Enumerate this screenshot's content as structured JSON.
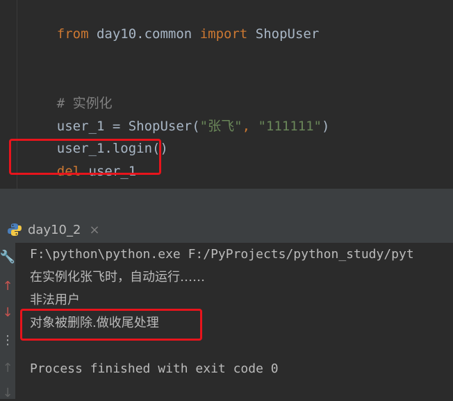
{
  "editor": {
    "line1": {
      "kw_from": "from",
      "module": " day10.common ",
      "kw_import": "import",
      "name": " ShopUser"
    },
    "line2": {
      "comment": "# 实例化"
    },
    "line3": {
      "var": "user_1 = ShopUser(",
      "arg1": "\"张飞\"",
      "comma": ", ",
      "arg2": "\"111111\"",
      "close": ")"
    },
    "line4": {
      "text": "user_1.login()"
    },
    "line5": {
      "kw_del": "del",
      "var": " user_1"
    }
  },
  "run_panel": {
    "tab_label": "day10_2",
    "tab_close": "×",
    "tools": {
      "wrench": "🔧",
      "up": "↑",
      "down": "↓",
      "more": "⋮",
      "up2": "↑",
      "down2": "↓"
    },
    "output": {
      "line1": "F:\\python\\python.exe F:/PyProjects/python_study/pyt",
      "line2": "在实例化张飞时，自动运行……",
      "line3": "非法用户",
      "line4": "对象被删除.做收尾处理",
      "line5": "Process finished with exit code 0"
    }
  },
  "colors": {
    "keyword": "#cc7832",
    "string": "#6a8759",
    "comment": "#808080",
    "highlight": "#e8141c"
  }
}
